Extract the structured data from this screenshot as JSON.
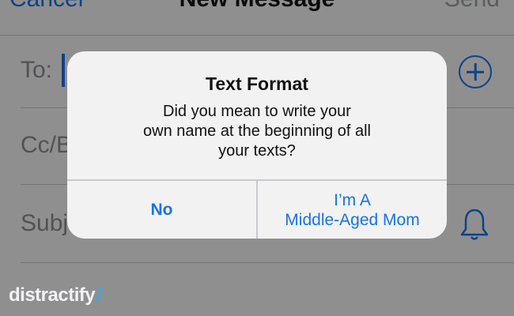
{
  "compose": {
    "nav": {
      "cancel_label": "Cancel",
      "title": "New Message",
      "send_label": "Send"
    },
    "fields": {
      "to_label": "To:",
      "cc_label": "Cc/B",
      "subject_label": "Subj"
    },
    "icons": {
      "add": "plus-circle-icon",
      "bell": "bell-icon"
    }
  },
  "alert": {
    "title": "Text Format",
    "message_lines": [
      "Did you mean to write your",
      "own name at the beginning of all",
      "your texts?"
    ],
    "buttons": {
      "no_label": "No",
      "mom_line1": "I’m A",
      "mom_line2": "Middle-Aged Mom"
    }
  },
  "watermark": {
    "text": "distractify",
    "slash": "/"
  },
  "colors": {
    "accent": "#1a73e8",
    "alert_bg": "#f2f2f3",
    "dim_overlay": "rgba(0,0,0,0.42)"
  }
}
